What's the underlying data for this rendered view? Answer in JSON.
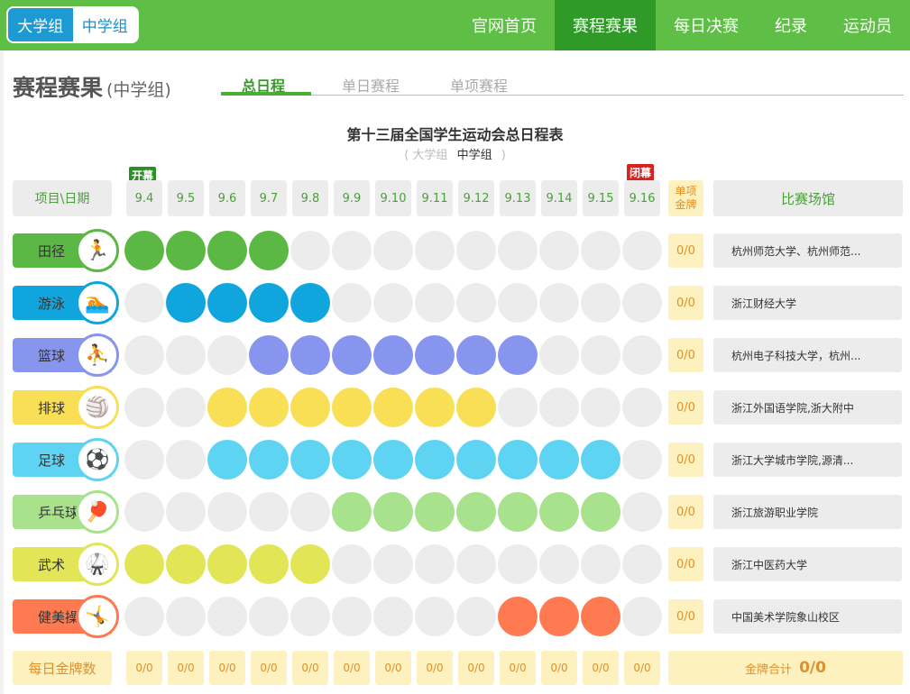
{
  "group_switch": {
    "university": "大学组",
    "middle_school": "中学组"
  },
  "nav": [
    "官网首页",
    "赛程赛果",
    "每日决赛",
    "纪录",
    "运动员"
  ],
  "page": {
    "title": "赛程赛果",
    "subtitle": "(中学组)"
  },
  "tabs": [
    "总日程",
    "单日赛程",
    "单项赛程"
  ],
  "schedule": {
    "title": "第十三届全国学生运动会总日程表",
    "sub_open": "(",
    "sub_university": "大学组",
    "sub_middle": "中学组",
    "sub_close": ")",
    "flag_open": "开幕",
    "flag_close": "闭幕",
    "header_item": "项目\\日期",
    "header_medal": "单项金牌",
    "header_venue": "比赛场馆",
    "dates": [
      "9.4",
      "9.5",
      "9.6",
      "9.7",
      "9.8",
      "9.9",
      "9.10",
      "9.11",
      "9.12",
      "9.13",
      "9.14",
      "9.15",
      "9.16"
    ]
  },
  "sports": [
    {
      "name": "田径",
      "color": "#5cb844",
      "logo": "🏃",
      "medals": "0/0",
      "venue": "杭州师范大学、杭州师范...",
      "days": [
        1,
        1,
        1,
        1,
        0,
        0,
        0,
        0,
        0,
        0,
        0,
        0,
        0
      ]
    },
    {
      "name": "游泳",
      "color": "#10a6dd",
      "logo": "🏊",
      "medals": "0/0",
      "venue": "浙江财经大学",
      "days": [
        0,
        1,
        1,
        1,
        1,
        0,
        0,
        0,
        0,
        0,
        0,
        0,
        0
      ]
    },
    {
      "name": "篮球",
      "color": "#8795ee",
      "logo": "⛹",
      "medals": "0/0",
      "venue": "杭州电子科技大学，杭州...",
      "days": [
        0,
        0,
        0,
        1,
        1,
        1,
        1,
        1,
        1,
        1,
        0,
        0,
        0
      ]
    },
    {
      "name": "排球",
      "color": "#f8df55",
      "logo": "🏐",
      "medals": "0/0",
      "venue": "浙江外国语学院,浙大附中",
      "days": [
        0,
        0,
        1,
        1,
        1,
        1,
        1,
        1,
        1,
        0,
        0,
        0,
        0
      ]
    },
    {
      "name": "足球",
      "color": "#5fd4f2",
      "logo": "⚽",
      "medals": "0/0",
      "venue": "浙江大学城市学院,源清...",
      "days": [
        0,
        0,
        1,
        1,
        1,
        1,
        1,
        1,
        1,
        1,
        1,
        1,
        0
      ]
    },
    {
      "name": "乒乓球",
      "color": "#a8e28d",
      "logo": "🏓",
      "medals": "0/0",
      "venue": "浙江旅游职业学院",
      "days": [
        0,
        0,
        0,
        0,
        0,
        1,
        1,
        1,
        1,
        1,
        1,
        1,
        0
      ]
    },
    {
      "name": "武术",
      "color": "#e2e656",
      "logo": "🥋",
      "medals": "0/0",
      "venue": "浙江中医药大学",
      "days": [
        1,
        1,
        1,
        1,
        1,
        0,
        0,
        0,
        0,
        0,
        0,
        0,
        0
      ]
    },
    {
      "name": "健美操",
      "color": "#ff7a50",
      "logo": "🤸",
      "medals": "0/0",
      "venue": "中国美术学院象山校区",
      "days": [
        0,
        0,
        0,
        0,
        0,
        0,
        0,
        0,
        0,
        1,
        1,
        1,
        0
      ]
    }
  ],
  "daily": {
    "label": "每日金牌数",
    "values": [
      "0/0",
      "0/0",
      "0/0",
      "0/0",
      "0/0",
      "0/0",
      "0/0",
      "0/0",
      "0/0",
      "0/0",
      "0/0",
      "0/0",
      "0/0"
    ],
    "total_label": "金牌合计",
    "total_value": "0/0"
  }
}
